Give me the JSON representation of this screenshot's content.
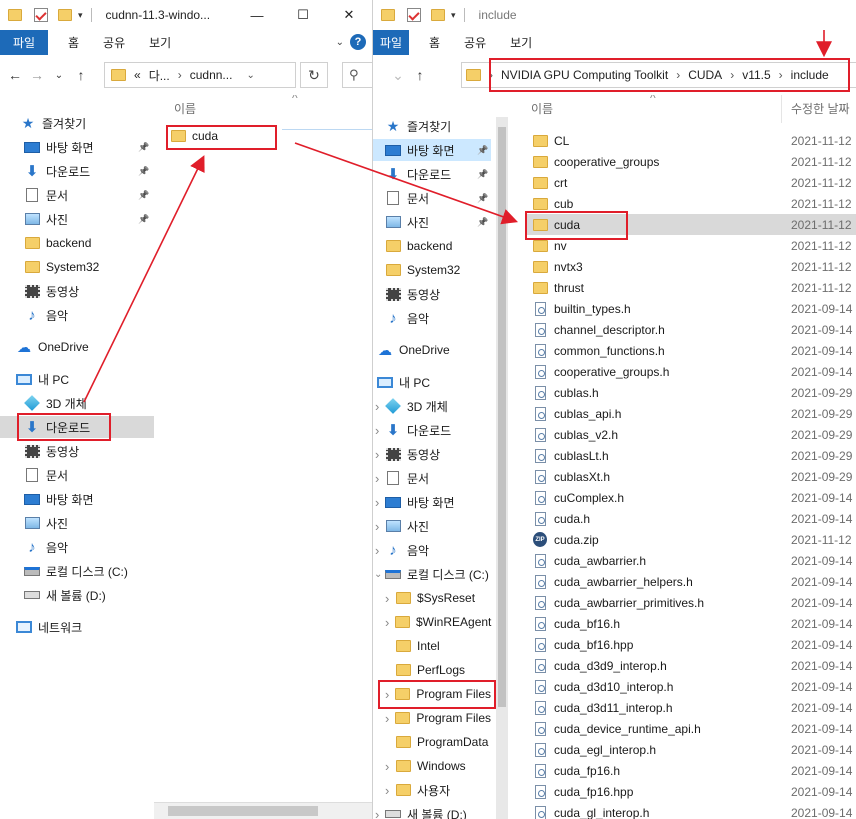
{
  "left_window": {
    "title": "cudnn-11.3-windo...",
    "ribbon": {
      "file": "파일",
      "tabs": [
        "홈",
        "공유",
        "보기"
      ],
      "help": "?"
    },
    "address": {
      "prefix": "«",
      "segments": [
        "다...",
        "cudnn..."
      ]
    },
    "nav": [
      {
        "label": "즐겨찾기",
        "icon": "star-icon"
      },
      {
        "label": "바탕 화면",
        "icon": "desktop-icon",
        "pinned": true
      },
      {
        "label": "다운로드",
        "icon": "download-icon",
        "pinned": true
      },
      {
        "label": "문서",
        "icon": "document-icon",
        "pinned": true
      },
      {
        "label": "사진",
        "icon": "pictures-icon",
        "pinned": true
      },
      {
        "label": "backend",
        "icon": "folder-icon"
      },
      {
        "label": "System32",
        "icon": "folder-icon"
      },
      {
        "label": "동영상",
        "icon": "video-icon"
      },
      {
        "label": "음악",
        "icon": "music-icon"
      },
      {
        "label": "OneDrive",
        "icon": "onedrive-icon"
      },
      {
        "label": "내 PC",
        "icon": "pc-icon"
      },
      {
        "label": "3D 개체",
        "icon": "3d-objects-icon"
      },
      {
        "label": "다운로드",
        "icon": "download-icon",
        "selected": true
      },
      {
        "label": "동영상",
        "icon": "video-icon"
      },
      {
        "label": "문서",
        "icon": "document-icon"
      },
      {
        "label": "바탕 화면",
        "icon": "desktop-icon"
      },
      {
        "label": "사진",
        "icon": "pictures-icon"
      },
      {
        "label": "음악",
        "icon": "music-icon"
      },
      {
        "label": "로컬 디스크 (C:)",
        "icon": "local-disk-icon"
      },
      {
        "label": "새 볼륨 (D:)",
        "icon": "drive-icon"
      },
      {
        "label": "네트워크",
        "icon": "network-icon"
      }
    ],
    "column_name": "이름",
    "files": [
      {
        "name": "cuda",
        "icon": "folder-icon"
      }
    ]
  },
  "right_window": {
    "title": "include",
    "ribbon": {
      "file": "파일",
      "tabs": [
        "홈",
        "공유",
        "보기"
      ]
    },
    "address": {
      "segments": [
        "NVIDIA GPU Computing Toolkit",
        "CUDA",
        "v11.5",
        "include"
      ]
    },
    "nav": [
      {
        "label": "즐겨찾기",
        "icon": "star-icon"
      },
      {
        "label": "바탕 화면",
        "icon": "desktop-icon",
        "pinned": true,
        "hilite": true
      },
      {
        "label": "다운로드",
        "icon": "download-icon",
        "pinned": true
      },
      {
        "label": "문서",
        "icon": "document-icon",
        "pinned": true
      },
      {
        "label": "사진",
        "icon": "pictures-icon",
        "pinned": true
      },
      {
        "label": "backend",
        "icon": "folder-icon"
      },
      {
        "label": "System32",
        "icon": "folder-icon"
      },
      {
        "label": "동영상",
        "icon": "video-icon"
      },
      {
        "label": "음악",
        "icon": "music-icon"
      },
      {
        "label": "OneDrive",
        "icon": "onedrive-icon"
      },
      {
        "label": "내 PC",
        "icon": "pc-icon"
      },
      {
        "label": "3D 개체",
        "icon": "3d-objects-icon",
        "expand": true
      },
      {
        "label": "다운로드",
        "icon": "download-icon",
        "expand": true
      },
      {
        "label": "동영상",
        "icon": "video-icon",
        "expand": true
      },
      {
        "label": "문서",
        "icon": "document-icon",
        "expand": true
      },
      {
        "label": "바탕 화면",
        "icon": "desktop-icon",
        "expand": true
      },
      {
        "label": "사진",
        "icon": "pictures-icon",
        "expand": true
      },
      {
        "label": "음악",
        "icon": "music-icon",
        "expand": true
      },
      {
        "label": "로컬 디스크 (C:)",
        "icon": "local-disk-icon",
        "expanded": true
      },
      {
        "label": "$SysReset",
        "icon": "folder-icon",
        "expand": true,
        "indent": true
      },
      {
        "label": "$WinREAgent",
        "icon": "folder-icon",
        "expand": true,
        "indent": true
      },
      {
        "label": "Intel",
        "icon": "folder-icon",
        "indent": true
      },
      {
        "label": "PerfLogs",
        "icon": "folder-icon",
        "indent": true
      },
      {
        "label": "Program Files",
        "icon": "folder-icon",
        "expand": true,
        "indent": true,
        "selected": true
      },
      {
        "label": "Program Files",
        "icon": "folder-icon",
        "expand": true,
        "indent": true
      },
      {
        "label": "ProgramData",
        "icon": "folder-icon",
        "indent": true
      },
      {
        "label": "Windows",
        "icon": "folder-icon",
        "expand": true,
        "indent": true
      },
      {
        "label": "사용자",
        "icon": "folder-icon",
        "expand": true,
        "indent": true
      },
      {
        "label": "새 볼륨 (D:)",
        "icon": "drive-icon",
        "expand": true
      }
    ],
    "column_name": "이름",
    "column_date": "수정한 날짜",
    "files": [
      {
        "name": "CL",
        "icon": "folder-icon",
        "date": "2021-11-12"
      },
      {
        "name": "cooperative_groups",
        "icon": "folder-icon",
        "date": "2021-11-12"
      },
      {
        "name": "crt",
        "icon": "folder-icon",
        "date": "2021-11-12"
      },
      {
        "name": "cub",
        "icon": "folder-icon",
        "date": "2021-11-12"
      },
      {
        "name": "cuda",
        "icon": "folder-icon",
        "date": "2021-11-12",
        "selected": true
      },
      {
        "name": "nv",
        "icon": "folder-icon",
        "date": "2021-11-12"
      },
      {
        "name": "nvtx3",
        "icon": "folder-icon",
        "date": "2021-11-12"
      },
      {
        "name": "thrust",
        "icon": "folder-icon",
        "date": "2021-11-12"
      },
      {
        "name": "builtin_types.h",
        "icon": "header-file-icon",
        "date": "2021-09-14"
      },
      {
        "name": "channel_descriptor.h",
        "icon": "header-file-icon",
        "date": "2021-09-14"
      },
      {
        "name": "common_functions.h",
        "icon": "header-file-icon",
        "date": "2021-09-14"
      },
      {
        "name": "cooperative_groups.h",
        "icon": "header-file-icon",
        "date": "2021-09-14"
      },
      {
        "name": "cublas.h",
        "icon": "header-file-icon",
        "date": "2021-09-29"
      },
      {
        "name": "cublas_api.h",
        "icon": "header-file-icon",
        "date": "2021-09-29"
      },
      {
        "name": "cublas_v2.h",
        "icon": "header-file-icon",
        "date": "2021-09-29"
      },
      {
        "name": "cublasLt.h",
        "icon": "header-file-icon",
        "date": "2021-09-29"
      },
      {
        "name": "cublasXt.h",
        "icon": "header-file-icon",
        "date": "2021-09-29"
      },
      {
        "name": "cuComplex.h",
        "icon": "header-file-icon",
        "date": "2021-09-14"
      },
      {
        "name": "cuda.h",
        "icon": "header-file-icon",
        "date": "2021-09-14"
      },
      {
        "name": "cuda.zip",
        "icon": "zip-icon",
        "date": "2021-11-12"
      },
      {
        "name": "cuda_awbarrier.h",
        "icon": "header-file-icon",
        "date": "2021-09-14"
      },
      {
        "name": "cuda_awbarrier_helpers.h",
        "icon": "header-file-icon",
        "date": "2021-09-14"
      },
      {
        "name": "cuda_awbarrier_primitives.h",
        "icon": "header-file-icon",
        "date": "2021-09-14"
      },
      {
        "name": "cuda_bf16.h",
        "icon": "header-file-icon",
        "date": "2021-09-14"
      },
      {
        "name": "cuda_bf16.hpp",
        "icon": "header-file-icon",
        "date": "2021-09-14"
      },
      {
        "name": "cuda_d3d9_interop.h",
        "icon": "header-file-icon",
        "date": "2021-09-14"
      },
      {
        "name": "cuda_d3d10_interop.h",
        "icon": "header-file-icon",
        "date": "2021-09-14"
      },
      {
        "name": "cuda_d3d11_interop.h",
        "icon": "header-file-icon",
        "date": "2021-09-14"
      },
      {
        "name": "cuda_device_runtime_api.h",
        "icon": "header-file-icon",
        "date": "2021-09-14"
      },
      {
        "name": "cuda_egl_interop.h",
        "icon": "header-file-icon",
        "date": "2021-09-14"
      },
      {
        "name": "cuda_fp16.h",
        "icon": "header-file-icon",
        "date": "2021-09-14"
      },
      {
        "name": "cuda_fp16.hpp",
        "icon": "header-file-icon",
        "date": "2021-09-14"
      },
      {
        "name": "cuda_gl_interop.h",
        "icon": "header-file-icon",
        "date": "2021-09-14"
      }
    ]
  },
  "annotation_color": "#e01e2a"
}
